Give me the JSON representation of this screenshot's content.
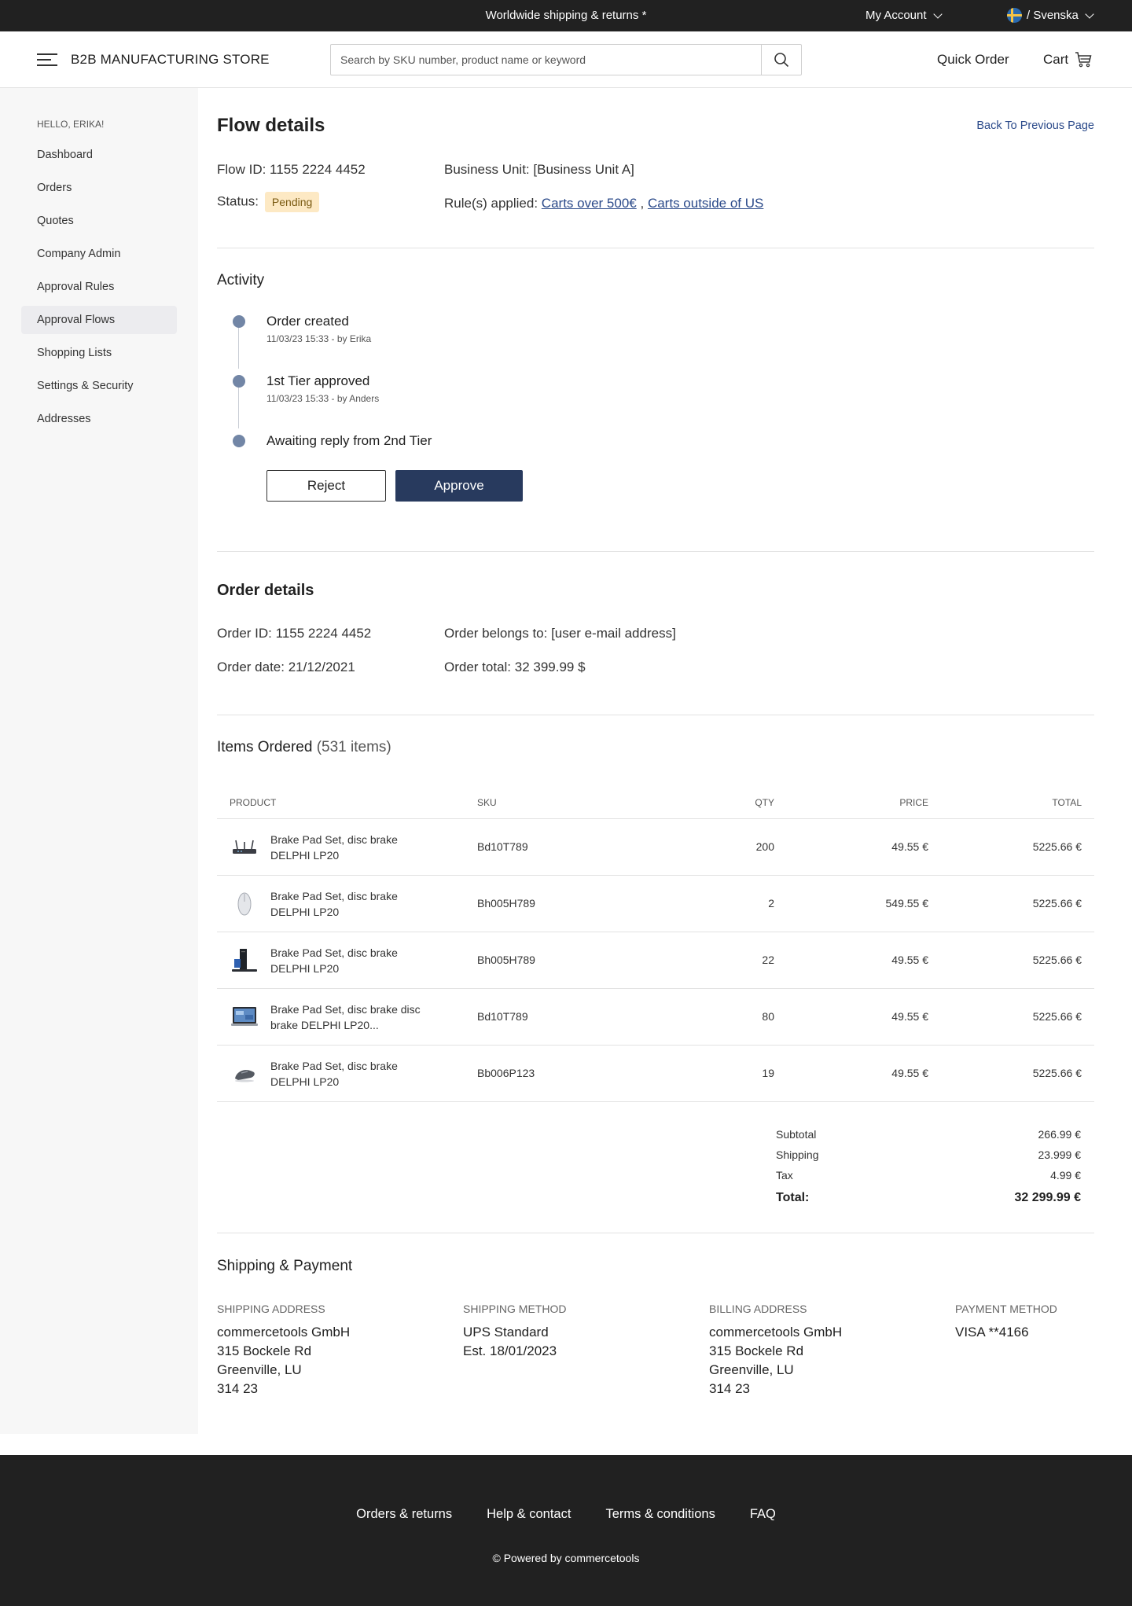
{
  "topbar": {
    "promo": "Worldwide shipping & returns *",
    "account": "My Account",
    "language": "/ Svenska"
  },
  "header": {
    "brand": "B2B MANUFACTURING STORE",
    "search_placeholder": "Search by SKU number, product name or keyword",
    "quick_order": "Quick Order",
    "cart": "Cart"
  },
  "sidebar": {
    "greeting": "HELLO, ERIKA!",
    "items": [
      {
        "label": "Dashboard"
      },
      {
        "label": "Orders"
      },
      {
        "label": "Quotes"
      },
      {
        "label": "Company Admin"
      },
      {
        "label": "Approval Rules"
      },
      {
        "label": "Approval Flows",
        "active": true
      },
      {
        "label": "Shopping Lists"
      },
      {
        "label": "Settings & Security"
      },
      {
        "label": "Addresses"
      }
    ]
  },
  "flow": {
    "title": "Flow details",
    "back": "Back To Previous Page",
    "flow_id": "Flow ID: 1155 2224 4452",
    "status_label": "Status:",
    "status": "Pending",
    "business_unit": "Business Unit: [Business Unit A]",
    "rules_label": "Rule(s) applied:",
    "rule_1": "Carts over 500€",
    "rule_sep": ",",
    "rule_2": "Carts outside of US"
  },
  "activity": {
    "title": "Activity",
    "events": [
      {
        "title": "Order created",
        "sub": "11/03/23 15:33 - by Erika"
      },
      {
        "title": "1st Tier approved",
        "sub": "11/03/23 15:33 - by Anders"
      },
      {
        "title": "Awaiting reply from 2nd Tier"
      }
    ],
    "reject": "Reject",
    "approve": "Approve"
  },
  "order": {
    "title": "Order details",
    "order_id": "Order ID: 1155 2224 4452",
    "order_date": "Order date: 21/12/2021",
    "belongs_to": "Order belongs to: [user e-mail address]",
    "order_total": "Order total: 32 399.99 $"
  },
  "items": {
    "title": "Items Ordered",
    "count": "(531 items)",
    "headers": {
      "product": "PRODUCT",
      "sku": "SKU",
      "qty": "QTY",
      "price": "PRICE",
      "total": "TOTAL"
    },
    "rows": [
      {
        "name": "Brake Pad Set, disc brake DELPHI LP20",
        "sku": "Bd10T789",
        "qty": "200",
        "price": "49.55 €",
        "total": "5225.66 €",
        "icon": "router-icon"
      },
      {
        "name": "Brake Pad Set, disc brake DELPHI LP20",
        "sku": "Bh005H789",
        "qty": "2",
        "price": "549.55 €",
        "total": "5225.66 €",
        "icon": "mouse-icon"
      },
      {
        "name": "Brake Pad Set, disc brake DELPHI LP20",
        "sku": "Bh005H789",
        "qty": "22",
        "price": "49.55 €",
        "total": "5225.66 €",
        "icon": "computer-icon"
      },
      {
        "name": "Brake Pad Set, disc brake disc brake DELPHI LP20...",
        "sku": "Bd10T789",
        "qty": "80",
        "price": "49.55 €",
        "total": "5225.66 €",
        "icon": "laptop-icon"
      },
      {
        "name": "Brake Pad Set, disc brake DELPHI LP20",
        "sku": "Bb006P123",
        "qty": "19",
        "price": "49.55 €",
        "total": "5225.66 €",
        "icon": "gaming-mouse-icon"
      }
    ]
  },
  "totals": {
    "subtotal_label": "Subtotal",
    "subtotal": "266.99 €",
    "shipping_label": "Shipping",
    "shipping": "23.999 €",
    "tax_label": "Tax",
    "tax": "4.99 €",
    "total_label": "Total:",
    "total": "32 299.99 €"
  },
  "shipping_payment": {
    "title": "Shipping & Payment",
    "shipping_address": {
      "label": "SHIPPING ADDRESS",
      "lines": [
        "commercetools GmbH",
        "315 Bockele Rd",
        "Greenville, LU",
        "314 23"
      ]
    },
    "shipping_method": {
      "label": "SHIPPING METHOD",
      "lines": [
        "UPS Standard",
        "Est. 18/01/2023"
      ]
    },
    "billing_address": {
      "label": "BILLING ADDRESS",
      "lines": [
        "commercetools GmbH",
        "315 Bockele Rd",
        "Greenville, LU",
        "314 23"
      ]
    },
    "payment_method": {
      "label": "PAYMENT METHOD",
      "lines": [
        "VISA **4166"
      ]
    }
  },
  "footer": {
    "links": [
      "Orders & returns",
      "Help & contact",
      "Terms & conditions",
      "FAQ"
    ],
    "powered": "© Powered by commercetools"
  },
  "colors": {
    "dark": "#212121",
    "approve": "#283a5e",
    "link": "#2b4a8a",
    "pending_bg": "#fde9c4",
    "timeline_dot": "#7286a6"
  }
}
